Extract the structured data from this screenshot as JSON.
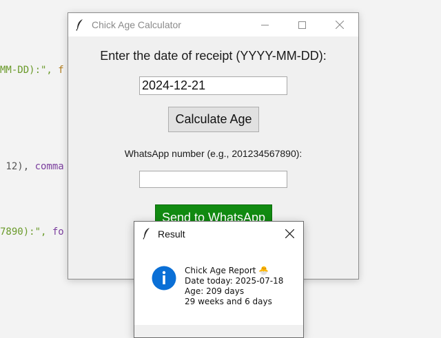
{
  "background_code": {
    "line1": {
      "a": "MM-DD):\", ",
      "b": "f"
    },
    "line2": {
      "a": " 12), ",
      "b": "comma"
    },
    "line3": {
      "a": "7890):\", ",
      "b": "fo"
    }
  },
  "main_window": {
    "title": "Chick Age Calculator",
    "icon": "feather-icon",
    "controls": [
      "minimize-icon",
      "maximize-icon",
      "close-icon"
    ],
    "date_prompt": "Enter the date of receipt (YYYY-MM-DD):",
    "date_value": "2024-12-21",
    "calculate_label": "Calculate Age",
    "whatsapp_prompt": "WhatsApp number (e.g., 201234567890):",
    "whatsapp_value": "",
    "send_label": "Send to WhatsApp",
    "send_color": "#118a11"
  },
  "result_dialog": {
    "title": "Result",
    "icon": "info-icon",
    "icon_color": "#0a6fd6",
    "lines": [
      "Chick Age Report 🐣",
      "Date today: 2025-07-18",
      "Age: 209 days",
      "29 weeks and 6 days"
    ]
  }
}
